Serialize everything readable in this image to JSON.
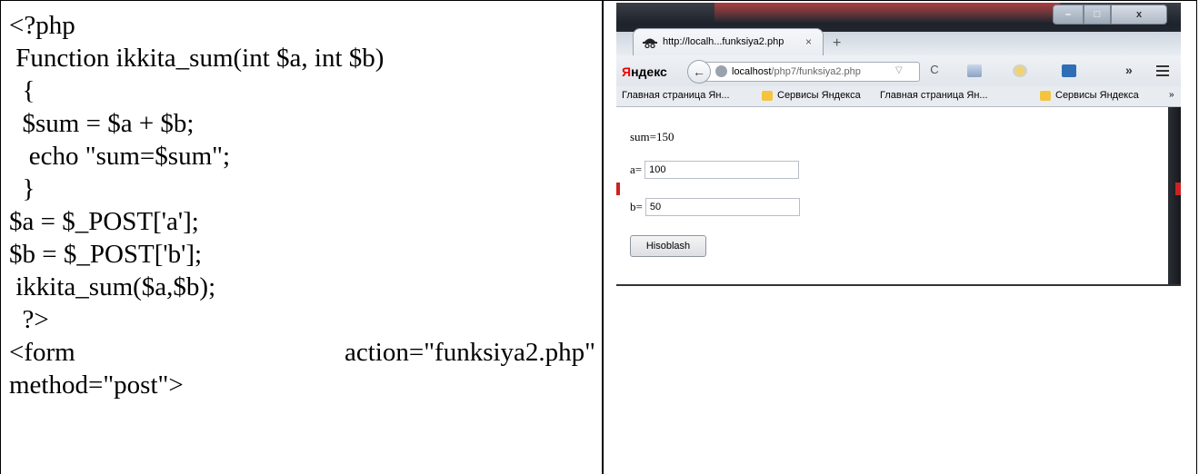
{
  "code": {
    "lines": [
      "<?php",
      " Function ikkita_sum(int $a, int $b)",
      "  {",
      "  $sum = $a + $b;",
      "   echo \"sum=$sum\";",
      "  }",
      "$a = $_POST['a'];",
      "$b = $_POST['b'];",
      " ikkita_sum($a,$b);",
      "  ?>"
    ],
    "form_line_left": "<form",
    "form_line_right": "action=\"funksiya2.php\"",
    "last_line": "method=\"post\">"
  },
  "browser": {
    "tab": {
      "title": "http://localh...funksiya2.php",
      "close": "×",
      "new_tab": "+"
    },
    "window_controls": {
      "minimize": "–",
      "maximize": "□",
      "close": "x"
    },
    "navbar": {
      "yandex_first": "Я",
      "yandex_rest": "ндекс",
      "back": "←",
      "url_host": "localhost",
      "url_path": "/php7/funksiya2.php",
      "url_dropdown": "▽",
      "reload": "C",
      "overflow": "»"
    },
    "bookmarks": [
      {
        "label": "Главная страница Ян...",
        "icon": "page-icon"
      },
      {
        "label": "Сервисы Яндекса",
        "icon": "folder-icon"
      },
      {
        "label": "Главная страница Ян...",
        "icon": "page-icon"
      },
      {
        "label": "Сервисы Яндекса",
        "icon": "folder-icon"
      }
    ],
    "bookmarks_more": "»",
    "page": {
      "result": "sum=150",
      "a_label": "a=",
      "a_value": "100",
      "b_label": "b=",
      "b_value": "50",
      "submit_label": "Hisoblash"
    },
    "colors": {
      "frame": "#2d323a",
      "accent_red": "#cc2222",
      "folder_yellow": "#f4c441"
    }
  }
}
